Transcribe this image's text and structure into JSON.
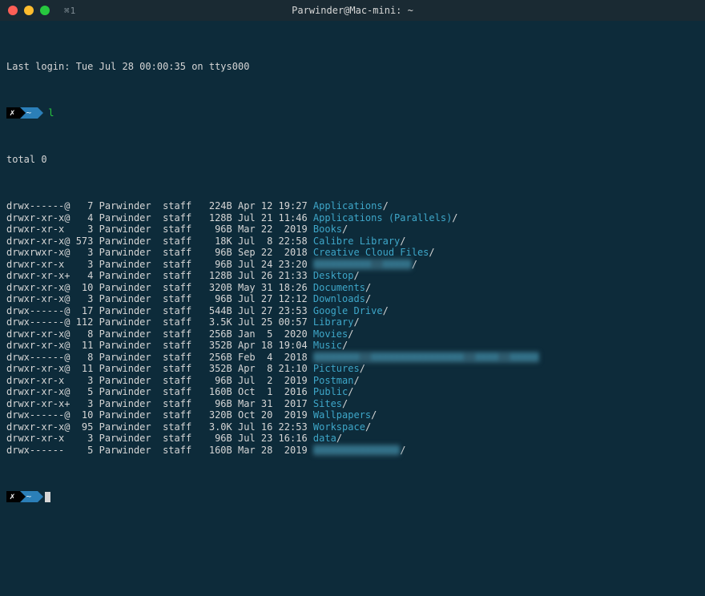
{
  "window": {
    "shortcut": "⌘1",
    "title": "Parwinder@Mac-mini: ~"
  },
  "last_login": "Last login: Tue Jul 28 00:00:35 on ttys000",
  "prompt": {
    "cross": "✗",
    "tilde": "~"
  },
  "command": "l",
  "total_line": "total 0",
  "listing": [
    {
      "perm": "drwx------@",
      "links": "  7",
      "user": "Parwinder",
      "group": "staff",
      "size": " 224B",
      "date": "Apr 12 19:27",
      "name": "Applications",
      "suffix": "/",
      "blurred": false
    },
    {
      "perm": "drwxr-xr-x@",
      "links": "  4",
      "user": "Parwinder",
      "group": "staff",
      "size": " 128B",
      "date": "Jul 21 11:46",
      "name": "Applications (Parallels)",
      "suffix": "/",
      "blurred": false
    },
    {
      "perm": "drwxr-xr-x ",
      "links": "  3",
      "user": "Parwinder",
      "group": "staff",
      "size": "  96B",
      "date": "Mar 22  2019",
      "name": "Books",
      "suffix": "/",
      "blurred": false
    },
    {
      "perm": "drwxr-xr-x@",
      "links": "573",
      "user": "Parwinder",
      "group": "staff",
      "size": "  18K",
      "date": "Jul  8 22:58",
      "name": "Calibre Library",
      "suffix": "/",
      "blurred": false
    },
    {
      "perm": "drwxrwxr-x@",
      "links": "  3",
      "user": "Parwinder",
      "group": "staff",
      "size": "  96B",
      "date": "Sep 22  2018",
      "name": "Creative Cloud Files",
      "suffix": "/",
      "blurred": false
    },
    {
      "perm": "drwxr-xr-x ",
      "links": "  3",
      "user": "Parwinder",
      "group": "staff",
      "size": "  96B",
      "date": "Jul 24 23:20",
      "name": "XXXXXXXXXX  XXXXX",
      "suffix": "/",
      "blurred": true
    },
    {
      "perm": "drwxr-xr-x+",
      "links": "  4",
      "user": "Parwinder",
      "group": "staff",
      "size": " 128B",
      "date": "Jul 26 21:33",
      "name": "Desktop",
      "suffix": "/",
      "blurred": false
    },
    {
      "perm": "drwxr-xr-x@",
      "links": " 10",
      "user": "Parwinder",
      "group": "staff",
      "size": " 320B",
      "date": "May 31 18:26",
      "name": "Documents",
      "suffix": "/",
      "blurred": false
    },
    {
      "perm": "drwxr-xr-x@",
      "links": "  3",
      "user": "Parwinder",
      "group": "staff",
      "size": "  96B",
      "date": "Jul 27 12:12",
      "name": "Downloads",
      "suffix": "/",
      "blurred": false
    },
    {
      "perm": "drwx------@",
      "links": " 17",
      "user": "Parwinder",
      "group": "staff",
      "size": " 544B",
      "date": "Jul 27 23:53",
      "name": "Google Drive",
      "suffix": "/",
      "blurred": false
    },
    {
      "perm": "drwx------@",
      "links": "112",
      "user": "Parwinder",
      "group": "staff",
      "size": " 3.5K",
      "date": "Jul 25 00:57",
      "name": "Library",
      "suffix": "/",
      "blurred": false
    },
    {
      "perm": "drwxr-xr-x@",
      "links": "  8",
      "user": "Parwinder",
      "group": "staff",
      "size": " 256B",
      "date": "Jan  5  2020",
      "name": "Movies",
      "suffix": "/",
      "blurred": false
    },
    {
      "perm": "drwxr-xr-x@",
      "links": " 11",
      "user": "Parwinder",
      "group": "staff",
      "size": " 352B",
      "date": "Apr 18 19:04",
      "name": "Music",
      "suffix": "/",
      "blurred": false
    },
    {
      "perm": "drwx------@",
      "links": "  8",
      "user": "Parwinder",
      "group": "staff",
      "size": " 256B",
      "date": "Feb  4  2018",
      "name": "XXXXXXXX  XXXXXXXXXXXXXXXX  XXXX  XXXXX",
      "suffix": "",
      "blurred": true
    },
    {
      "perm": "drwxr-xr-x@",
      "links": " 11",
      "user": "Parwinder",
      "group": "staff",
      "size": " 352B",
      "date": "Apr  8 21:10",
      "name": "Pictures",
      "suffix": "/",
      "blurred": false
    },
    {
      "perm": "drwxr-xr-x ",
      "links": "  3",
      "user": "Parwinder",
      "group": "staff",
      "size": "  96B",
      "date": "Jul  2  2019",
      "name": "Postman",
      "suffix": "/",
      "blurred": false
    },
    {
      "perm": "drwxr-xr-x@",
      "links": "  5",
      "user": "Parwinder",
      "group": "staff",
      "size": " 160B",
      "date": "Oct  1  2016",
      "name": "Public",
      "suffix": "/",
      "blurred": false
    },
    {
      "perm": "drwxr-xr-x+",
      "links": "  3",
      "user": "Parwinder",
      "group": "staff",
      "size": "  96B",
      "date": "Mar 31  2017",
      "name": "Sites",
      "suffix": "/",
      "blurred": false
    },
    {
      "perm": "drwx------@",
      "links": " 10",
      "user": "Parwinder",
      "group": "staff",
      "size": " 320B",
      "date": "Oct 20  2019",
      "name": "Wallpapers",
      "suffix": "/",
      "blurred": false
    },
    {
      "perm": "drwxr-xr-x@",
      "links": " 95",
      "user": "Parwinder",
      "group": "staff",
      "size": " 3.0K",
      "date": "Jul 16 22:53",
      "name": "Workspace",
      "suffix": "/",
      "blurred": false
    },
    {
      "perm": "drwxr-xr-x ",
      "links": "  3",
      "user": "Parwinder",
      "group": "staff",
      "size": "  96B",
      "date": "Jul 23 16:16",
      "name": "data",
      "suffix": "/",
      "blurred": false
    },
    {
      "perm": "drwx------ ",
      "links": "  5",
      "user": "Parwinder",
      "group": "staff",
      "size": " 160B",
      "date": "Mar 28  2019",
      "name": "XXXXXXXXXXXXXXX",
      "suffix": "/",
      "blurred": true
    }
  ]
}
